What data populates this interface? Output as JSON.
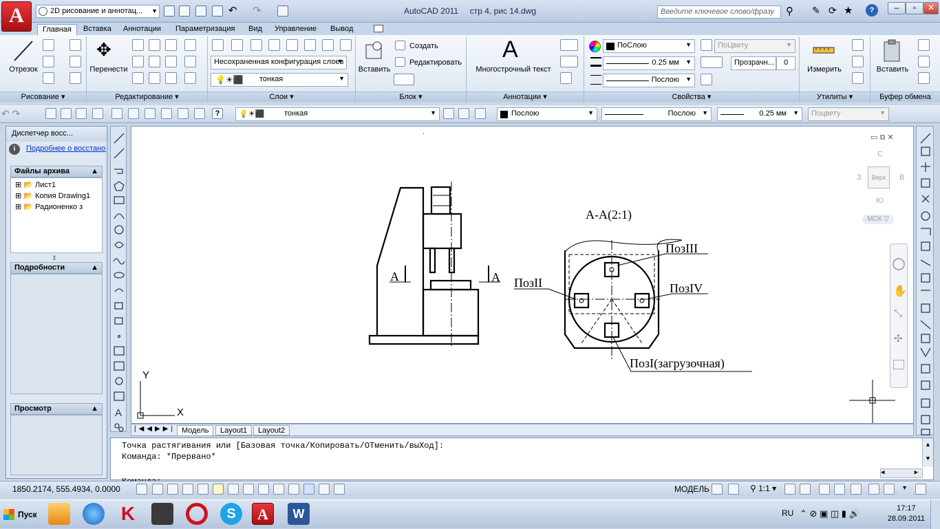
{
  "titlebar": {
    "workspace": "2D рисование и аннотац...",
    "app": "AutoCAD 2011",
    "file": "стр 4, рис 14.dwg",
    "search_placeholder": "Введите ключевое слово/фразу"
  },
  "tabs": [
    "Главная",
    "Вставка",
    "Аннотации",
    "Параметризация",
    "Вид",
    "Управление",
    "Вывод"
  ],
  "ribbon": {
    "draw": {
      "title": "Рисование",
      "line": "Отрезок"
    },
    "modify": {
      "title": "Редактирование",
      "move": "Перенести"
    },
    "layers": {
      "title": "Слои",
      "state": "Несохраненная конфигурация слоев",
      "current": "тонкая"
    },
    "block": {
      "title": "Блок",
      "insert": "Вставить",
      "create": "Создать",
      "edit": "Редактировать"
    },
    "annot": {
      "title": "Аннотации",
      "mtext": "Многострочный текст"
    },
    "props": {
      "title": "Свойства",
      "color": "ПоСлою",
      "lineweight": "0.25 мм",
      "linetype": "Послою",
      "plotstyle": "ПоЦвету",
      "transp_label": "Прозрачн...",
      "transp": "0"
    },
    "utils": {
      "title": "Утилиты",
      "measure": "Измерить"
    },
    "clip": {
      "title": "Буфер обмена",
      "paste": "Вставить"
    }
  },
  "toolbar2": {
    "layer": "тонкая",
    "color": "Послою",
    "linetype": "Послою",
    "lineweight": "0.25 мм",
    "plotstyle": "Поцвету"
  },
  "palette": {
    "title": "Диспетчер восс...",
    "link": "Подробнее о восстановлении",
    "files_title": "Файлы архива",
    "files": [
      "Лист1",
      "Копия Drawing1",
      "Радионенко з"
    ],
    "details_title": "Подробности",
    "preview_title": "Просмотр"
  },
  "viewcube": {
    "n": "С",
    "s": "Ю",
    "w": "З",
    "e": "В",
    "top": "Верх",
    "ucs": "МСК"
  },
  "drawing": {
    "section": "А-А(2:1)",
    "poz1": "ПозI(загрузочная)",
    "poz2": "ПозII",
    "poz3": "ПозIII",
    "poz4": "ПозIV",
    "cut": "А",
    "y": "Y",
    "x": "X"
  },
  "layout_tabs": [
    "Модель",
    "Layout1",
    "Layout2"
  ],
  "command": [
    "Точка растягивания или [Базовая точка/Копировать/ОТменить/выХод]:",
    "Команда: *Прервано*",
    "Команда:"
  ],
  "status": {
    "coords": "1850.2174, 555.4934, 0.0000",
    "model": "МОДЕЛЬ",
    "scale": "1:1"
  },
  "taskbar": {
    "start": "Пуск",
    "lang": "RU",
    "time": "17:17",
    "date": "28.09.2011"
  }
}
